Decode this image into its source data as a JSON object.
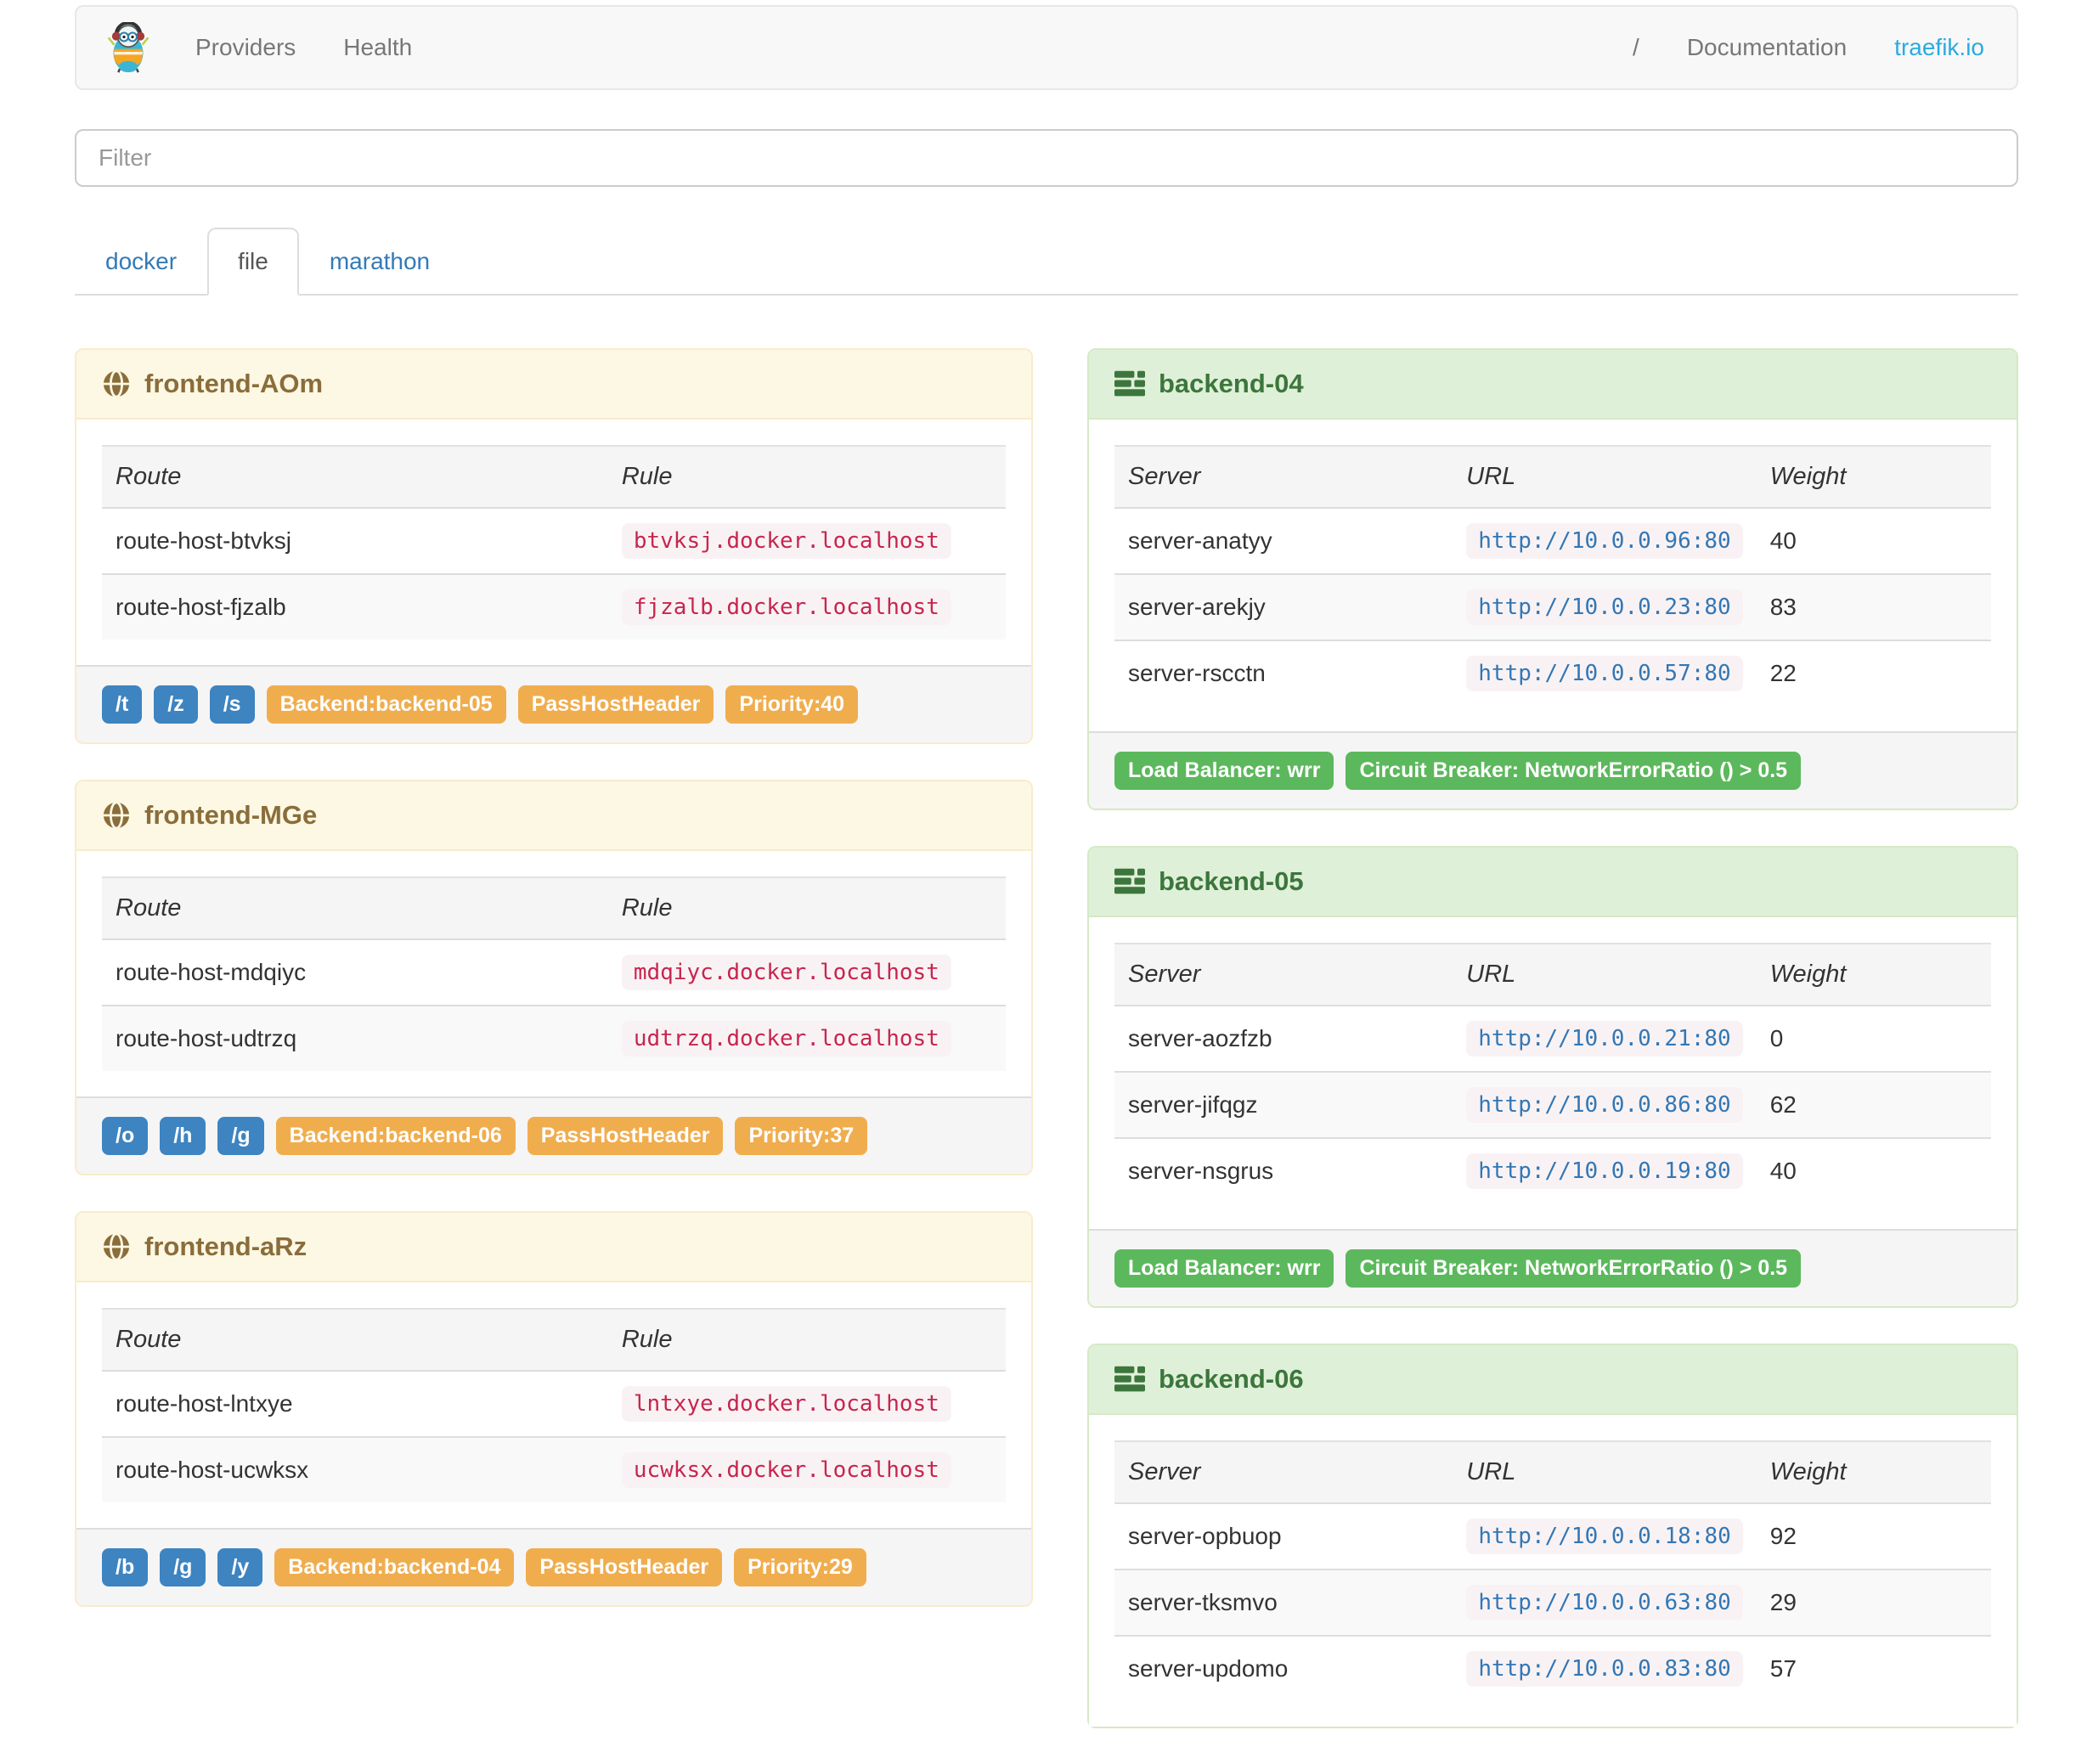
{
  "navbar": {
    "providers_label": "Providers",
    "health_label": "Health",
    "separator": "/",
    "documentation_label": "Documentation",
    "brand_link_label": "traefik.io"
  },
  "filter": {
    "placeholder": "Filter"
  },
  "tabs": [
    {
      "label": "docker",
      "active": false
    },
    {
      "label": "file",
      "active": true
    },
    {
      "label": "marathon",
      "active": false
    }
  ],
  "columns": {
    "frontend": {
      "route": "Route",
      "rule": "Rule"
    },
    "backend": {
      "server": "Server",
      "url": "URL",
      "weight": "Weight"
    }
  },
  "frontends": [
    {
      "title": "frontend-AOm",
      "routes": [
        {
          "route": "route-host-btvksj",
          "rule": "btvksj.docker.localhost"
        },
        {
          "route": "route-host-fjzalb",
          "rule": "fjzalb.docker.localhost"
        }
      ],
      "entry_points": [
        "/t",
        "/z",
        "/s"
      ],
      "tags": [
        "Backend:backend-05",
        "PassHostHeader",
        "Priority:40"
      ]
    },
    {
      "title": "frontend-MGe",
      "routes": [
        {
          "route": "route-host-mdqiyc",
          "rule": "mdqiyc.docker.localhost"
        },
        {
          "route": "route-host-udtrzq",
          "rule": "udtrzq.docker.localhost"
        }
      ],
      "entry_points": [
        "/o",
        "/h",
        "/g"
      ],
      "tags": [
        "Backend:backend-06",
        "PassHostHeader",
        "Priority:37"
      ]
    },
    {
      "title": "frontend-aRz",
      "routes": [
        {
          "route": "route-host-lntxye",
          "rule": "lntxye.docker.localhost"
        },
        {
          "route": "route-host-ucwksx",
          "rule": "ucwksx.docker.localhost"
        }
      ],
      "entry_points": [
        "/b",
        "/g",
        "/y"
      ],
      "tags": [
        "Backend:backend-04",
        "PassHostHeader",
        "Priority:29"
      ]
    }
  ],
  "backends": [
    {
      "title": "backend-04",
      "servers": [
        {
          "server": "server-anatyy",
          "url": "http://10.0.0.96:80",
          "weight": 40
        },
        {
          "server": "server-arekjy",
          "url": "http://10.0.0.23:80",
          "weight": 83
        },
        {
          "server": "server-rscctn",
          "url": "http://10.0.0.57:80",
          "weight": 22
        }
      ],
      "footer_tags": [
        "Load Balancer: wrr",
        "Circuit Breaker: NetworkErrorRatio () > 0.5"
      ]
    },
    {
      "title": "backend-05",
      "servers": [
        {
          "server": "server-aozfzb",
          "url": "http://10.0.0.21:80",
          "weight": 0
        },
        {
          "server": "server-jifqgz",
          "url": "http://10.0.0.86:80",
          "weight": 62
        },
        {
          "server": "server-nsgrus",
          "url": "http://10.0.0.19:80",
          "weight": 40
        }
      ],
      "footer_tags": [
        "Load Balancer: wrr",
        "Circuit Breaker: NetworkErrorRatio () > 0.5"
      ]
    },
    {
      "title": "backend-06",
      "servers": [
        {
          "server": "server-opbuop",
          "url": "http://10.0.0.18:80",
          "weight": 92
        },
        {
          "server": "server-tksmvo",
          "url": "http://10.0.0.63:80",
          "weight": 29
        },
        {
          "server": "server-updomo",
          "url": "http://10.0.0.83:80",
          "weight": 57
        }
      ],
      "footer_tags": []
    }
  ],
  "colors": {
    "brand_blue": "#2aabe2",
    "tab_link_blue": "#337ab7",
    "label_blue": "#3d84c1",
    "label_orange": "#f0ad4e",
    "label_green": "#5cb85c",
    "rule_code_red": "#c7254e",
    "url_code_blue": "#3277b5",
    "frontend_header_bg": "#fcf8e3",
    "frontend_header_text": "#8a6d3b",
    "backend_header_bg": "#dff0d8",
    "backend_header_text": "#3c763d"
  }
}
